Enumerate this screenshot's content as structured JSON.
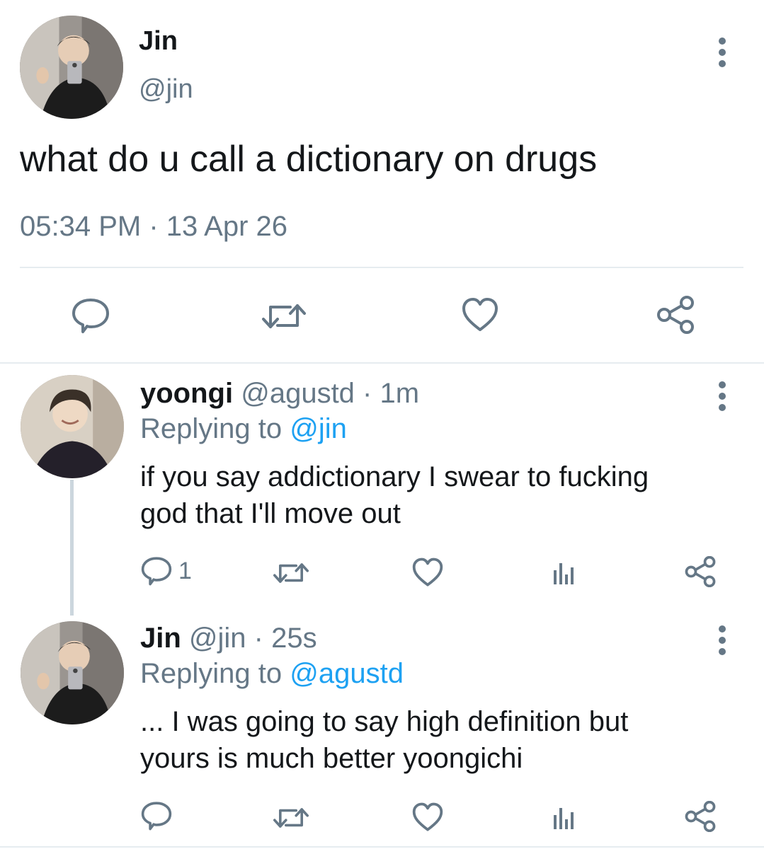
{
  "main_tweet": {
    "display_name": "Jin",
    "handle": "@jin",
    "text": "what do u call a dictionary on drugs",
    "timestamp": "05:34 PM · 13 Apr 26",
    "actions": [
      "reply-icon",
      "retweet-icon",
      "like-icon",
      "share-icon"
    ]
  },
  "replies": [
    {
      "display_name": "yoongi",
      "handle": "@agustd",
      "age": "· 1m",
      "replying_label": "Replying to",
      "replying_to": "@jin",
      "text_line1": "if you say addictionary I swear to fucking",
      "text_line2": "god that I'll move out",
      "reply_count": "1",
      "actions": [
        "reply-icon",
        "retweet-icon",
        "like-icon",
        "analytics-icon",
        "share-icon"
      ]
    },
    {
      "display_name": "Jin",
      "handle": "@jin",
      "age": "· 25s",
      "replying_label": "Replying to",
      "replying_to": "@agustd",
      "text_line1": "... I was going to say high definition but",
      "text_line2": "yours is much better yoongichi",
      "reply_count": "",
      "actions": [
        "reply-icon",
        "retweet-icon",
        "like-icon",
        "analytics-icon",
        "share-icon"
      ]
    }
  ],
  "colors": {
    "link": "#1da1f2",
    "secondary": "#657786",
    "text": "#14171a"
  }
}
